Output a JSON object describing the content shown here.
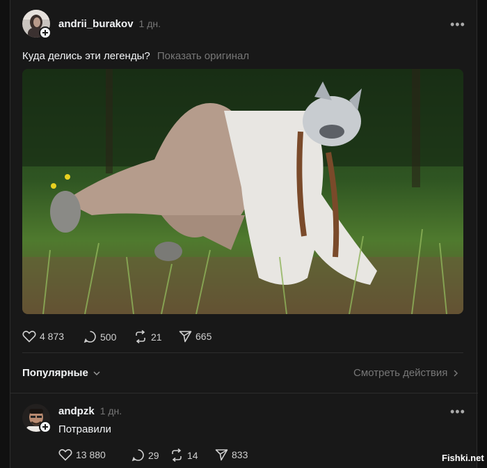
{
  "post": {
    "username": "andrii_burakov",
    "time": "1 дн.",
    "text": "Куда делись эти легенды?",
    "translate_label": "Показать оригинал",
    "actions": {
      "likes": "4 873",
      "comments": "500",
      "reposts": "21",
      "shares": "665"
    }
  },
  "replies_header": {
    "sort_label": "Популярные",
    "view_activity_label": "Смотреть действия"
  },
  "reply": {
    "username": "andpzk",
    "time": "1 дн.",
    "text": "Потравили",
    "actions": {
      "likes": "13 880",
      "comments": "29",
      "reposts": "14",
      "shares": "833"
    }
  },
  "watermark": "Fishki.net",
  "icons": [
    "heart-icon",
    "comment-icon",
    "repost-icon",
    "share-icon",
    "more-icon",
    "plus-icon",
    "chevron-down-icon",
    "chevron-right-icon"
  ],
  "colors": {
    "background": "#181818",
    "text": "#f3f5f7",
    "muted": "#777777",
    "divider": "#2d2d2d"
  }
}
